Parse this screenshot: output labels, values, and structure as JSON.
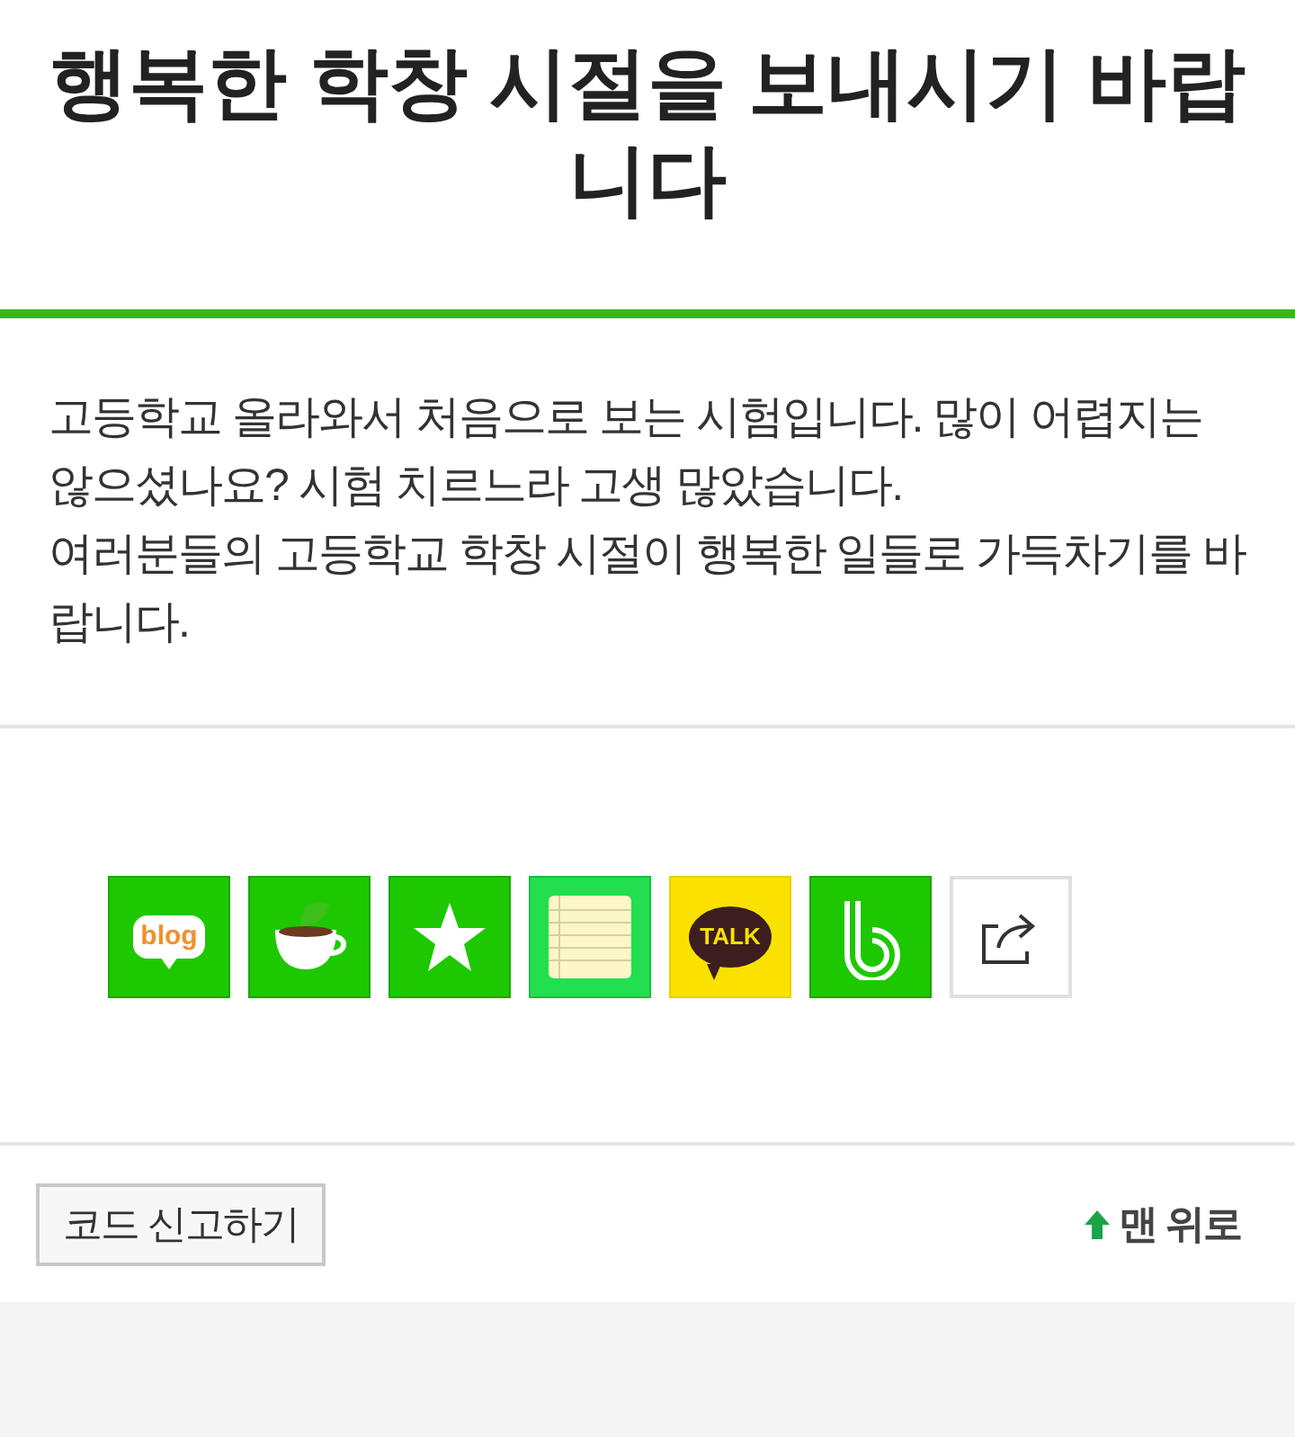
{
  "title": "행복한 학창 시절을 보내시기 바랍니다",
  "paragraphs": [
    "고등학교 올라와서 처음으로 보는 시험입니다. 많이 어렵지는 않으셨나요? 시험 치르느라 고생 많았습니다.",
    "여러분들의 고등학교 학창 시절이 행복한 일들로 가득차기를 바랍니다."
  ],
  "share_buttons": [
    {
      "kind": "blog",
      "label": "blog"
    },
    {
      "kind": "cafe"
    },
    {
      "kind": "star"
    },
    {
      "kind": "memo"
    },
    {
      "kind": "talk",
      "label": "TALK"
    },
    {
      "kind": "band"
    },
    {
      "kind": "share"
    }
  ],
  "footer": {
    "report_button": "코드 신고하기",
    "top_link": "맨 위로"
  }
}
